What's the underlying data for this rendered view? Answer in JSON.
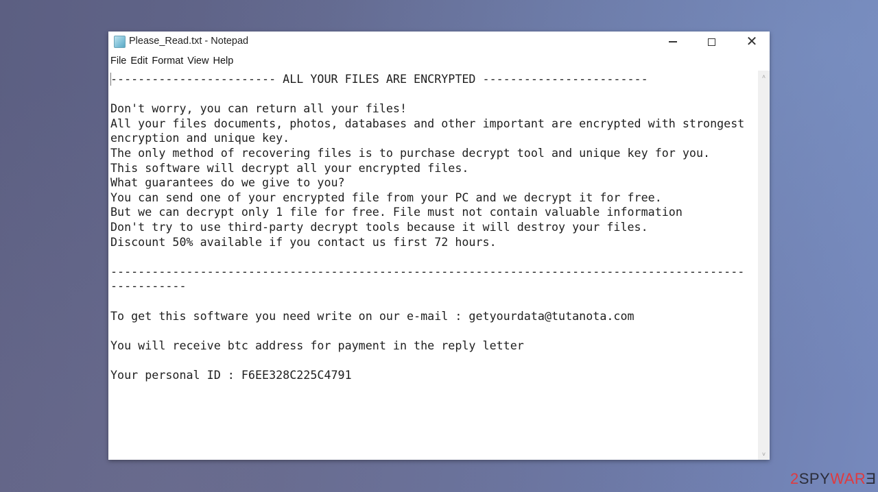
{
  "window": {
    "title": "Please_Read.txt - Notepad",
    "app_icon": "notepad-icon",
    "controls": {
      "minimize": "minimize-icon",
      "maximize": "maximize-icon",
      "close": "close-icon",
      "close_glyph": "✕"
    }
  },
  "menubar": {
    "items": [
      {
        "label": "File"
      },
      {
        "label": "Edit"
      },
      {
        "label": "Format"
      },
      {
        "label": "View"
      },
      {
        "label": "Help"
      }
    ]
  },
  "document": {
    "lines": [
      "------------------------ ALL YOUR FILES ARE ENCRYPTED ------------------------",
      "",
      "Don't worry, you can return all your files!",
      "All your files documents, photos, databases and other important are encrypted with strongest",
      "encryption and unique key.",
      "The only method of recovering files is to purchase decrypt tool and unique key for you.",
      "This software will decrypt all your encrypted files.",
      "What guarantees do we give to you?",
      "You can send one of your encrypted file from your PC and we decrypt it for free.",
      "But we can decrypt only 1 file for free. File must not contain valuable information",
      "Don't try to use third-party decrypt tools because it will destroy your files.",
      "Discount 50% available if you contact us first 72 hours.",
      "",
      "--------------------------------------------------------------------------------------------",
      "-----------",
      "",
      "To get this software you need write on our e-mail : getyourdata@tutanota.com",
      "",
      "You will receive btc address for payment in the reply letter",
      "",
      "Your personal ID : F6EE328C225C4791"
    ]
  },
  "scrollbar": {
    "up_glyph": "˄",
    "down_glyph": "˅"
  },
  "watermark": {
    "part1": "2",
    "part2": "SPY",
    "part3": "WAR",
    "part4": "Ǝ"
  },
  "colors": {
    "watermark_red": "#e03a3e",
    "watermark_dark": "#2b2d3a"
  }
}
